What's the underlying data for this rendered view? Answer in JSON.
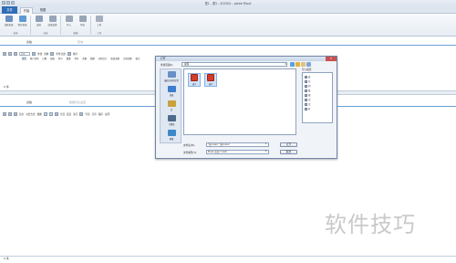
{
  "window": {
    "title": "表1 - 表2 - 202301 - Jointe Filout"
  },
  "ribbon": {
    "file_tab": "文件",
    "tabs": [
      "开始",
      "视图"
    ],
    "buttons": [
      {
        "label": "读取表格",
        "icon": "table-open-icon",
        "color": "#6b8fc0"
      },
      {
        "label": "保存表格",
        "icon": "table-save-icon",
        "color": "#5d9bd5"
      },
      {
        "label": "连接",
        "icon": "link-icon",
        "color": "#8ea0b8"
      },
      {
        "label": "连接设置",
        "icon": "link-settings-icon",
        "color": "#98a6b9"
      },
      {
        "label": "导入",
        "icon": "import-icon",
        "color": "#9aa6b5"
      },
      {
        "label": "导出",
        "icon": "export-icon",
        "color": "#9aa6b5"
      },
      {
        "label": "工具",
        "icon": "tool-icon",
        "color": "#a5afbd"
      }
    ],
    "groups": [
      "表格",
      "连接",
      "数据",
      "工具"
    ]
  },
  "top_panel": {
    "tabs": [
      "表格",
      "查询"
    ],
    "search_placeholder": "搜索",
    "toolbar_items": [
      "查找",
      "替换",
      "条件过滤",
      "排序"
    ],
    "columns": [
      "序号",
      "客户名称",
      "日期",
      "规格",
      "型号",
      "数量",
      "单价",
      "金额",
      "税额",
      "价税合计",
      "收款金额",
      "欠款金额",
      "备注"
    ],
    "status": "0 条"
  },
  "bottom_panel": {
    "tabs": [
      "表格",
      "数据对比设置"
    ],
    "toolbar_items": [
      "显示",
      "对比方式",
      "视图",
      "全选",
      "反选",
      "清空",
      "导出",
      "打印",
      "保存",
      "关闭"
    ],
    "status": "0 条"
  },
  "dialog": {
    "title": "打开",
    "look_in_label": "查找范围(I):",
    "look_in_value": "桌面",
    "places": [
      {
        "label": "最近访问的位置",
        "color": "#6a8fc7"
      },
      {
        "label": "桌面",
        "color": "#3d7dc9"
      },
      {
        "label": "库",
        "color": "#c9a23d"
      },
      {
        "label": "计算机",
        "color": "#4f6b8a"
      },
      {
        "label": "网络",
        "color": "#3f88c9"
      }
    ],
    "files": [
      "表1",
      "表2"
    ],
    "filename_label": "文件名(N):",
    "filename_value": "\"表1.xlsx\" \"表2.xlsx\"",
    "filetype_label": "文件类型(T):",
    "filetype_value": "Excel 文档 (*.xls*)",
    "open_button": "打开",
    "cancel_button": "取消",
    "options_title": "导入模式",
    "options": [
      {
        "label": "表",
        "checked": true
      },
      {
        "label": "行",
        "checked": true
      },
      {
        "label": "列",
        "checked": true
      },
      {
        "label": "值",
        "checked": true
      },
      {
        "label": "格",
        "checked": true
      },
      {
        "label": "式",
        "checked": true
      },
      {
        "label": "注",
        "checked": true
      },
      {
        "label": "名",
        "checked": true
      }
    ]
  },
  "watermark": "软件技巧"
}
